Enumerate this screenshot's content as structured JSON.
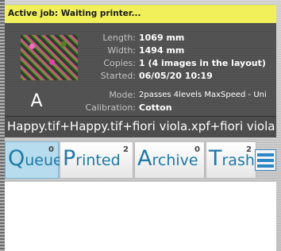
{
  "banner": {
    "text": "Active job: Waiting printer..."
  },
  "job": {
    "length_label": "Length:",
    "length": "1069 mm",
    "width_label": "Width:",
    "width": "1494 mm",
    "copies_label": "Copies:",
    "copies": "1 (4 images in the layout)",
    "started_label": "Started:",
    "started": "06/05/20 10:19",
    "mode_label": "Mode:",
    "mode": "2passes 4levels MaxSpeed - Uni",
    "calibration_label": "Calibration:",
    "calibration": "Cotton",
    "thumb_letter": "A"
  },
  "files": {
    "text": "Happy.tif+Happy.tif+fiori viola.xpf+fiori viola.xpf"
  },
  "tabs": [
    {
      "first": "Q",
      "rest": "ueue",
      "count": "0"
    },
    {
      "first": "P",
      "rest": "rinted",
      "count": "2"
    },
    {
      "first": "A",
      "rest": "rchive",
      "count": "0"
    },
    {
      "first": "T",
      "rest": "rash",
      "count": "2"
    }
  ],
  "colors": {
    "accent": "#1d7aa6",
    "active_tab": "#b7dcee",
    "banner": "#f1f05a"
  },
  "menu": {
    "icon": "hamburger-menu-icon"
  }
}
